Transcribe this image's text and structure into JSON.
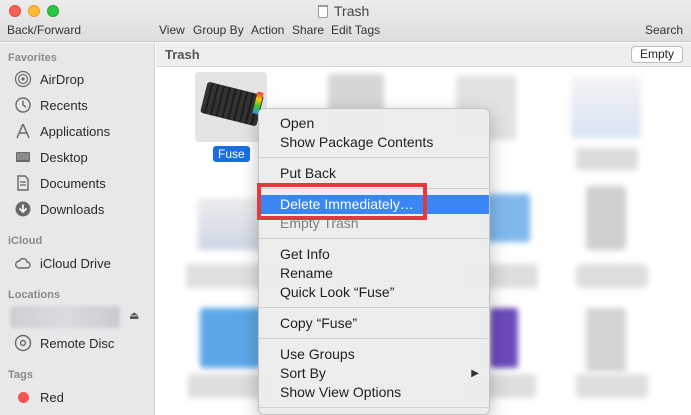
{
  "window": {
    "title": "Trash"
  },
  "toolbar": {
    "back_forward": "Back/Forward",
    "view": "View",
    "group_by": "Group By",
    "action": "Action",
    "share": "Share",
    "edit_tags": "Edit Tags",
    "search": "Search"
  },
  "sidebar": {
    "favorites_header": "Favorites",
    "favorites": [
      {
        "label": "AirDrop",
        "icon": "airdrop-icon"
      },
      {
        "label": "Recents",
        "icon": "clock-icon"
      },
      {
        "label": "Applications",
        "icon": "applications-icon"
      },
      {
        "label": "Desktop",
        "icon": "desktop-icon"
      },
      {
        "label": "Documents",
        "icon": "document-icon"
      },
      {
        "label": "Downloads",
        "icon": "download-icon"
      }
    ],
    "icloud_header": "iCloud",
    "icloud_drive": "iCloud Drive",
    "locations_header": "Locations",
    "remote_disc": "Remote Disc",
    "tags_header": "Tags",
    "tag_red": "Red",
    "tag_red_color": "#f25450"
  },
  "pathbar": {
    "title": "Trash",
    "empty_button": "Empty"
  },
  "files": {
    "selected_label": "Fuse"
  },
  "context_menu": {
    "items": [
      "Open",
      "Show Package Contents",
      "Put Back",
      "Delete Immediately…",
      "Empty Trash",
      "Get Info",
      "Rename",
      "Quick Look “Fuse”",
      "Copy “Fuse”",
      "Use Groups",
      "Sort By",
      "Show View Options"
    ],
    "highlight_color": "#3a86f5"
  },
  "annotation": {
    "color": "#e2393e"
  }
}
